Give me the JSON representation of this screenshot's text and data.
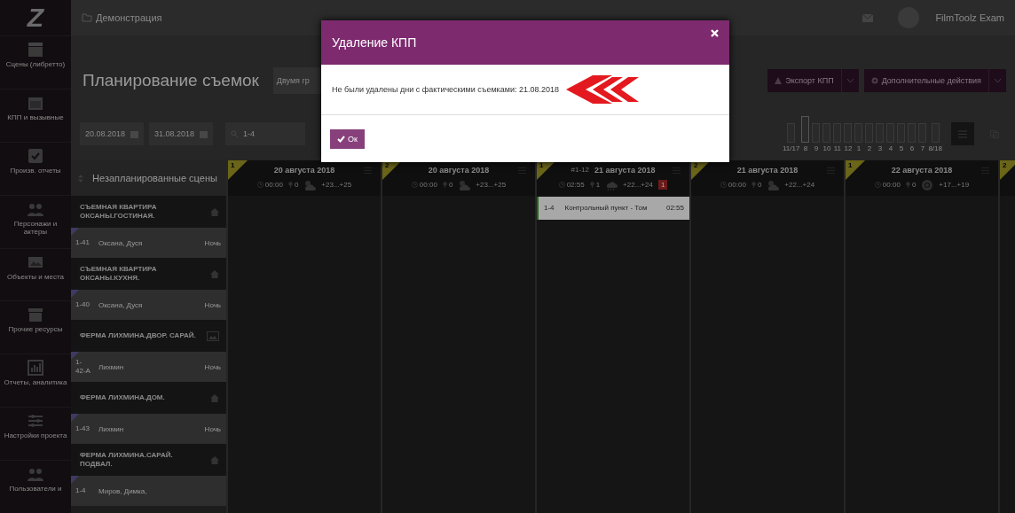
{
  "sidebar": {
    "logo": "Z",
    "items": [
      {
        "label": "Сцены (либретто)"
      },
      {
        "label": "КПП и вызывные"
      },
      {
        "label": "Произв. отчеты"
      },
      {
        "label": "Персонажи и актеры"
      },
      {
        "label": "Объекты и места"
      },
      {
        "label": "Прочие ресурсы"
      },
      {
        "label": "Отчеты, аналитика"
      },
      {
        "label": "Настройки проекта"
      },
      {
        "label": "Пользователи и"
      }
    ]
  },
  "header": {
    "breadcrumb": "Демонстрация",
    "user_name": "FilmToolz Exam"
  },
  "title_bar": {
    "title": "Планирование съемок",
    "view_select": "Двумя гр",
    "buttons": [
      {
        "label": "Экспорт КПП",
        "kind": "export"
      },
      {
        "label": "Дополнительные действия",
        "kind": "gear"
      }
    ]
  },
  "toolbar": {
    "date_from": "20.08.2018",
    "date_to": "31.08.2018",
    "search": "1-4",
    "timeline_labels": [
      "11/17",
      "8",
      "9",
      "10",
      "11",
      "12",
      "1",
      "2",
      "3",
      "4",
      "5",
      "6",
      "7",
      "8/18"
    ],
    "view_buttons": [
      {
        "selected": true
      },
      {
        "selected": false
      }
    ]
  },
  "unscheduled": {
    "title": "Незапланированные сцены",
    "groups": [
      {
        "location": "СЪЕМНАЯ КВАРТИРА ОКСАНЫ.ГОСТИНАЯ.",
        "kind": "home",
        "scenes": [
          {
            "number": "1-41",
            "characters": "Оксана, Дуся",
            "time": "Ночь"
          }
        ]
      },
      {
        "location": "СЪЕМНАЯ КВАРТИРА ОКСАНЫ.КУХНЯ.",
        "kind": "home",
        "scenes": [
          {
            "number": "1-40",
            "characters": "Оксана, Дуся",
            "time": "Ночь"
          }
        ]
      },
      {
        "location": "ФЕРМА ЛИХМИНА.ДВОР. САРАЙ.",
        "kind": "image",
        "scenes": [
          {
            "number": "1-42-А",
            "characters": "Лихмин",
            "time": "Ночь"
          }
        ]
      },
      {
        "location": "ФЕРМА ЛИХМИНА.ДОМ.",
        "kind": "home",
        "scenes": [
          {
            "number": "1-43",
            "characters": "Лихмин",
            "time": "Ночь"
          }
        ]
      },
      {
        "location": "ФЕРМА ЛИХМИНА.САРАЙ. ПОДВАЛ.",
        "kind": "home",
        "scenes": [
          {
            "number": "1-4",
            "characters": "Миров, Димка,"
          }
        ]
      }
    ]
  },
  "days": [
    {
      "unit": "1",
      "date": "20 августа 2018",
      "duration": "00:00",
      "count": "0",
      "kind": "cloudy",
      "temps": "+23...+25"
    },
    {
      "unit": "2",
      "date": "20 августа 2018",
      "duration": "00:00",
      "count": "0",
      "kind": "cloudy",
      "temps": "+23...+25"
    },
    {
      "unit": "1",
      "prefix": "#1-12",
      "date": "21 августа 2018",
      "duration": "02:55",
      "count": "1",
      "kind": "rain",
      "temps": "+22...+24",
      "alert": "1",
      "cards": [
        {
          "number": "1-4",
          "title": "Контрольный пункт - Том",
          "duration": "02:55"
        }
      ]
    },
    {
      "unit": "2",
      "date": "21 августа 2018",
      "duration": "00:00",
      "count": "0",
      "kind": "cloudy",
      "temps": "+22...+24"
    },
    {
      "unit": "1",
      "date": "22 августа 2018",
      "duration": "00:00",
      "count": "0",
      "kind": "sun",
      "temps": "+17...+19"
    },
    {
      "unit": "2"
    }
  ],
  "modal": {
    "title": "Удаление КПП",
    "message": "Не были удалены дни с фактическими съемками: 21.08.2018",
    "ok": "Ок"
  }
}
